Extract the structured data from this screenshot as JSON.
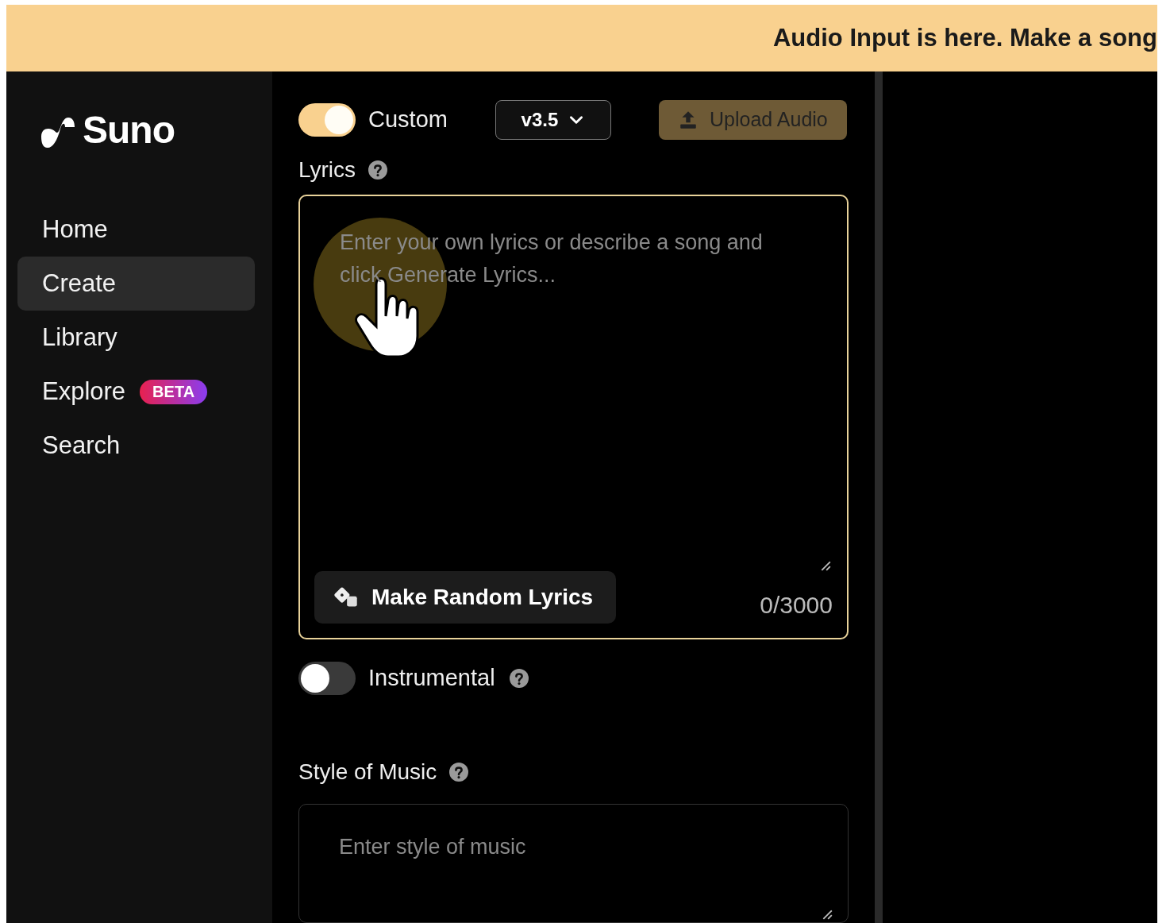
{
  "banner": {
    "text": "Audio Input is here. Make a song"
  },
  "logo": {
    "text": "Suno"
  },
  "nav": [
    {
      "label": "Home",
      "selected": false
    },
    {
      "label": "Create",
      "selected": true
    },
    {
      "label": "Library",
      "selected": false
    },
    {
      "label": "Explore",
      "selected": false,
      "badge": "BETA"
    },
    {
      "label": "Search",
      "selected": false
    }
  ],
  "custom_toggle": {
    "label": "Custom",
    "on": true
  },
  "version_select": {
    "value": "v3.5"
  },
  "upload_button": {
    "label": "Upload Audio"
  },
  "lyrics": {
    "label": "Lyrics",
    "placeholder": "Enter your own lyrics or describe a song and click Generate Lyrics...",
    "random_button": "Make Random Lyrics",
    "counter": "0/3000"
  },
  "instrumental_toggle": {
    "label": "Instrumental",
    "on": false
  },
  "style": {
    "label": "Style of Music",
    "placeholder": "Enter style of music"
  }
}
